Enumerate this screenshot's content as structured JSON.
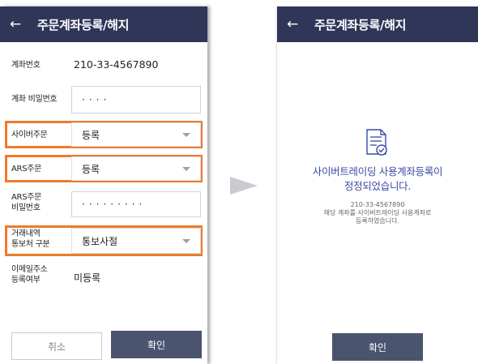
{
  "left_screen": {
    "header": {
      "back_icon": "←",
      "title": "주문계좌등록/해지"
    },
    "account_number": {
      "label": "계좌번호",
      "value": "210-33-4567890"
    },
    "account_password": {
      "label": "계좌 비밀번호",
      "value": "····"
    },
    "cyber_order": {
      "label": "사이버주문",
      "value": "등록"
    },
    "ars_order": {
      "label": "ARS주문",
      "value": "등록"
    },
    "ars_password": {
      "label_line1": "ARS주문",
      "label_line2": "비밀번호",
      "value": "·········"
    },
    "trade_notice": {
      "label_line1": "거래내역",
      "label_line2": "통보처 구분",
      "value": "통보사절"
    },
    "email": {
      "label_line1": "이메일주소",
      "label_line2": "등록여부",
      "value": "미등록"
    },
    "buttons": {
      "cancel": "취소",
      "confirm": "확인"
    },
    "highlight_color": "#ee7a2d"
  },
  "right_screen": {
    "header": {
      "back_icon": "←",
      "title": "주문계좌등록/해지"
    },
    "result_icon": "document-check-icon",
    "result_title_line1": "사이버트레이딩 사용계좌등록이",
    "result_title_line2": "정정되었습니다.",
    "account_number": "210-33-4567890",
    "desc_line1": "해당 계좌를 사이버트레이딩 사용계좌로",
    "desc_line2": "등록하였습니다.",
    "confirm_button": "확인"
  },
  "colors": {
    "header_bg": "#2f3657",
    "button_bg": "#4b546f",
    "accent_text": "#3a4aa5"
  }
}
